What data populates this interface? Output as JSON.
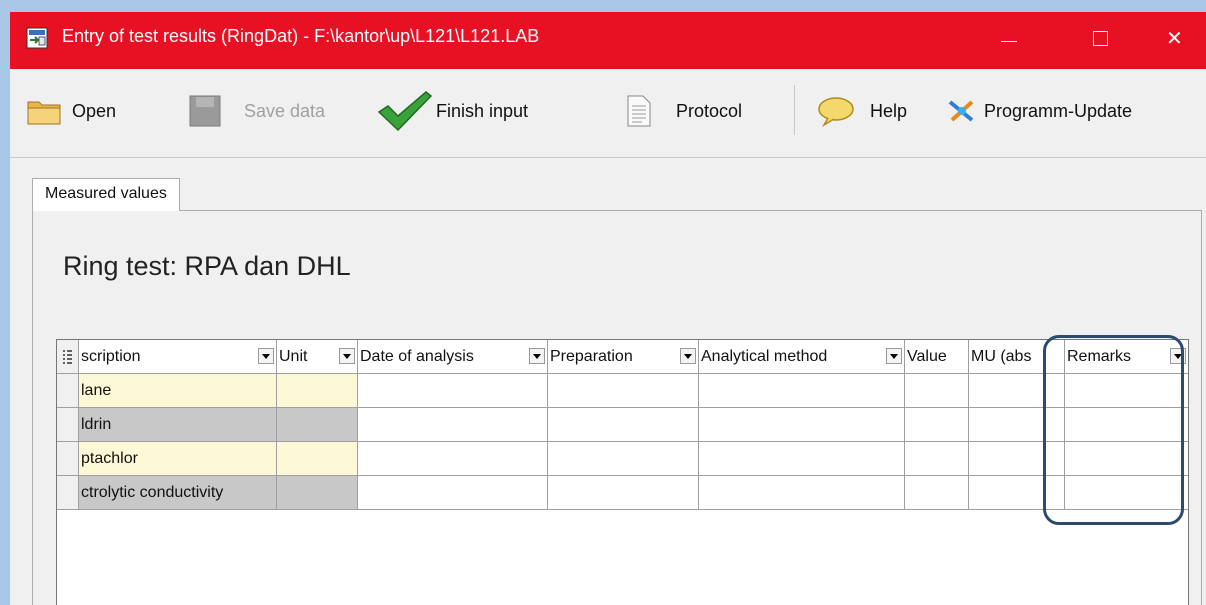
{
  "window": {
    "title": "Entry of test results (RingDat) - F:\\kantor\\up\\L121\\L121.LAB",
    "close_glyph": "✕"
  },
  "toolbar": {
    "open_label": "Open",
    "save_label": "Save data",
    "finish_label": "Finish input",
    "protocol_label": "Protocol",
    "help_label": "Help",
    "update_label": "Programm-Update"
  },
  "tabs": [
    {
      "label": "Measured values",
      "active": true
    }
  ],
  "page": {
    "title": "Ring test: RPA dan DHL"
  },
  "grid": {
    "columns": [
      {
        "label": "scription",
        "dropdown": true
      },
      {
        "label": "Unit",
        "dropdown": true
      },
      {
        "label": "Date of analysis",
        "dropdown": true
      },
      {
        "label": "Preparation",
        "dropdown": true
      },
      {
        "label": "Analytical method",
        "dropdown": true
      },
      {
        "label": "Value",
        "dropdown": false
      },
      {
        "label": "MU (abs",
        "dropdown": false
      },
      {
        "label": "Remarks",
        "dropdown": true
      }
    ],
    "rows": [
      {
        "description": "lane",
        "unit": "",
        "state": "yellow"
      },
      {
        "description": "ldrin",
        "unit": "",
        "state": "grey"
      },
      {
        "description": "ptachlor",
        "unit": "",
        "state": "yellow"
      },
      {
        "description": "ctrolytic conductivity",
        "unit": "",
        "state": "grey"
      }
    ]
  },
  "colors": {
    "titlebar": "#e81123",
    "highlight": "#2d4a71",
    "yellow_cell": "#fdf8d5",
    "grey_cell": "#c8c8c8"
  }
}
